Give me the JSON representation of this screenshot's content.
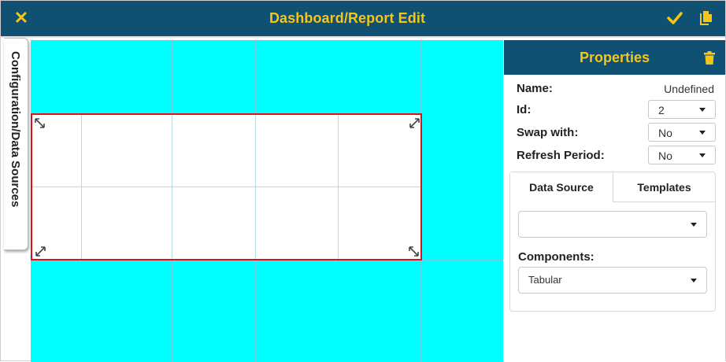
{
  "header": {
    "title": "Dashboard/Report Edit",
    "close_icon": "close-icon",
    "save_icon": "checkmark-icon",
    "copy_icon": "copy-icon"
  },
  "side_tab": {
    "label": "Configuration/Data Sources"
  },
  "properties": {
    "title": "Properties",
    "delete_icon": "trash-icon",
    "name_label": "Name:",
    "name_value": "Undefined",
    "id_label": "Id:",
    "id_value": "2",
    "swap_label": "Swap with:",
    "swap_value": "No",
    "refresh_label": "Refresh Period:",
    "refresh_value": "No",
    "tabs": [
      {
        "label": "Data Source",
        "active": true
      },
      {
        "label": "Templates",
        "active": false
      }
    ],
    "data_source_value": "",
    "components_label": "Components:",
    "components_value": "Tabular"
  },
  "colors": {
    "header_bg": "#0f5073",
    "header_text": "#f5c518",
    "canvas_bg": "#00ffff",
    "selection_border": "#d9141c"
  }
}
